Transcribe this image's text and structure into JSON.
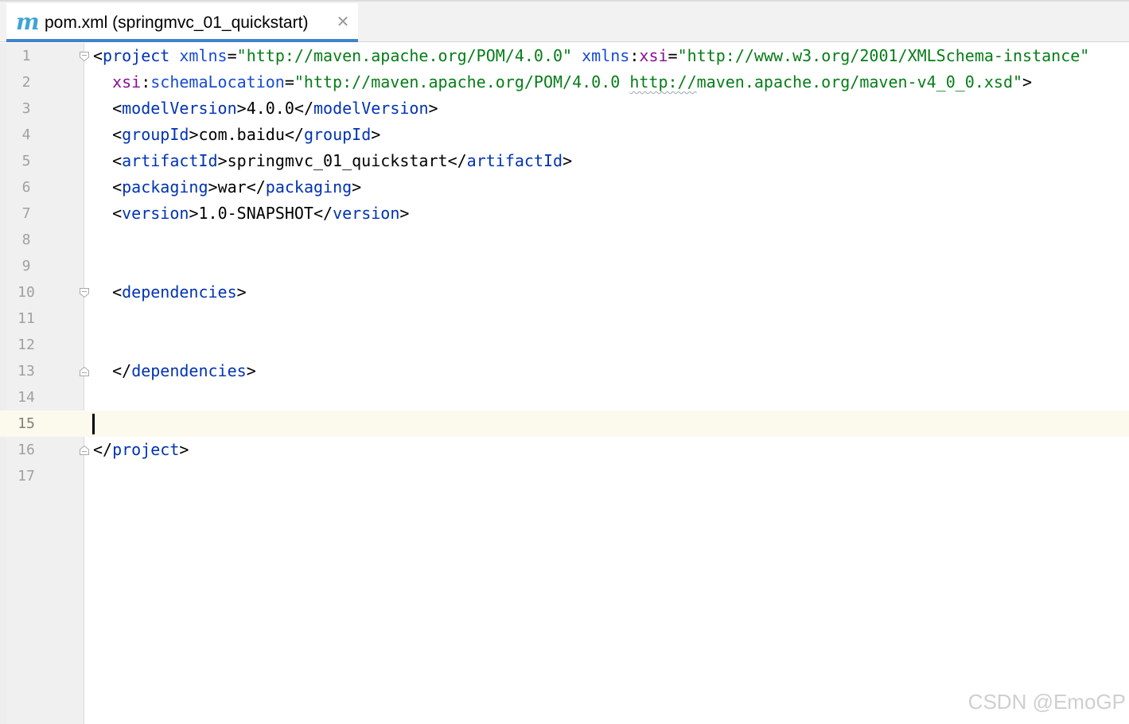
{
  "tab": {
    "icon": "maven-icon",
    "icon_glyph": "m",
    "title": "pom.xml (springmvc_01_quickstart)",
    "close_glyph": "✕"
  },
  "editor": {
    "current_line": 15,
    "lines": [
      {
        "n": "1",
        "fold": "open",
        "segments": [
          [
            "punct",
            "<"
          ],
          [
            "tag",
            "project"
          ],
          [
            "plain",
            " "
          ],
          [
            "attr",
            "xmlns"
          ],
          [
            "punct",
            "="
          ],
          [
            "val",
            "\"http://maven.apache.org/POM/4.0.0\""
          ],
          [
            "plain",
            " "
          ],
          [
            "attr",
            "xmlns"
          ],
          [
            "punct",
            ":"
          ],
          [
            "ns",
            "xsi"
          ],
          [
            "punct",
            "="
          ],
          [
            "val",
            "\"http://www.w3.org/2001/XMLSchema-instance\""
          ]
        ]
      },
      {
        "n": "2",
        "fold": "",
        "segments": [
          [
            "plain",
            "  "
          ],
          [
            "ns",
            "xsi"
          ],
          [
            "punct",
            ":"
          ],
          [
            "attr",
            "schemaLocation"
          ],
          [
            "punct",
            "="
          ],
          [
            "val",
            "\"http://maven.apache.org/POM/4.0.0 "
          ],
          [
            "valwavy",
            "http://"
          ],
          [
            "val",
            "maven.apache.org/maven-v4_0_0.xsd\""
          ],
          [
            "punct",
            ">"
          ]
        ]
      },
      {
        "n": "3",
        "fold": "",
        "segments": [
          [
            "plain",
            "  "
          ],
          [
            "punct",
            "<"
          ],
          [
            "tag",
            "modelVersion"
          ],
          [
            "punct",
            ">"
          ],
          [
            "plain",
            "4.0.0"
          ],
          [
            "punct",
            "</"
          ],
          [
            "tag",
            "modelVersion"
          ],
          [
            "punct",
            ">"
          ]
        ]
      },
      {
        "n": "4",
        "fold": "",
        "segments": [
          [
            "plain",
            "  "
          ],
          [
            "punct",
            "<"
          ],
          [
            "tag",
            "groupId"
          ],
          [
            "punct",
            ">"
          ],
          [
            "plain",
            "com.baidu"
          ],
          [
            "punct",
            "</"
          ],
          [
            "tag",
            "groupId"
          ],
          [
            "punct",
            ">"
          ]
        ]
      },
      {
        "n": "5",
        "fold": "",
        "segments": [
          [
            "plain",
            "  "
          ],
          [
            "punct",
            "<"
          ],
          [
            "tag",
            "artifactId"
          ],
          [
            "punct",
            ">"
          ],
          [
            "plain",
            "springmvc_01_quickstart"
          ],
          [
            "punct",
            "</"
          ],
          [
            "tag",
            "artifactId"
          ],
          [
            "punct",
            ">"
          ]
        ]
      },
      {
        "n": "6",
        "fold": "",
        "segments": [
          [
            "plain",
            "  "
          ],
          [
            "punct",
            "<"
          ],
          [
            "tag",
            "packaging"
          ],
          [
            "punct",
            ">"
          ],
          [
            "plain",
            "war"
          ],
          [
            "punct",
            "</"
          ],
          [
            "tag",
            "packaging"
          ],
          [
            "punct",
            ">"
          ]
        ]
      },
      {
        "n": "7",
        "fold": "",
        "segments": [
          [
            "plain",
            "  "
          ],
          [
            "punct",
            "<"
          ],
          [
            "tag",
            "version"
          ],
          [
            "punct",
            ">"
          ],
          [
            "plain",
            "1.0-SNAPSHOT"
          ],
          [
            "punct",
            "</"
          ],
          [
            "tag",
            "version"
          ],
          [
            "punct",
            ">"
          ]
        ]
      },
      {
        "n": "8",
        "fold": "",
        "segments": []
      },
      {
        "n": "9",
        "fold": "",
        "segments": []
      },
      {
        "n": "10",
        "fold": "open",
        "segments": [
          [
            "plain",
            "  "
          ],
          [
            "punct",
            "<"
          ],
          [
            "tag",
            "dependencies"
          ],
          [
            "punct",
            ">"
          ]
        ]
      },
      {
        "n": "11",
        "fold": "",
        "segments": []
      },
      {
        "n": "12",
        "fold": "",
        "segments": []
      },
      {
        "n": "13",
        "fold": "close",
        "segments": [
          [
            "plain",
            "  "
          ],
          [
            "punct",
            "</"
          ],
          [
            "tag",
            "dependencies"
          ],
          [
            "punct",
            ">"
          ]
        ]
      },
      {
        "n": "14",
        "fold": "",
        "segments": []
      },
      {
        "n": "15",
        "fold": "",
        "segments": []
      },
      {
        "n": "16",
        "fold": "close",
        "segments": [
          [
            "punct",
            "</"
          ],
          [
            "tag",
            "project"
          ],
          [
            "punct",
            ">"
          ]
        ]
      },
      {
        "n": "17",
        "fold": "",
        "segments": []
      }
    ]
  },
  "watermark": "CSDN @EmoGP"
}
